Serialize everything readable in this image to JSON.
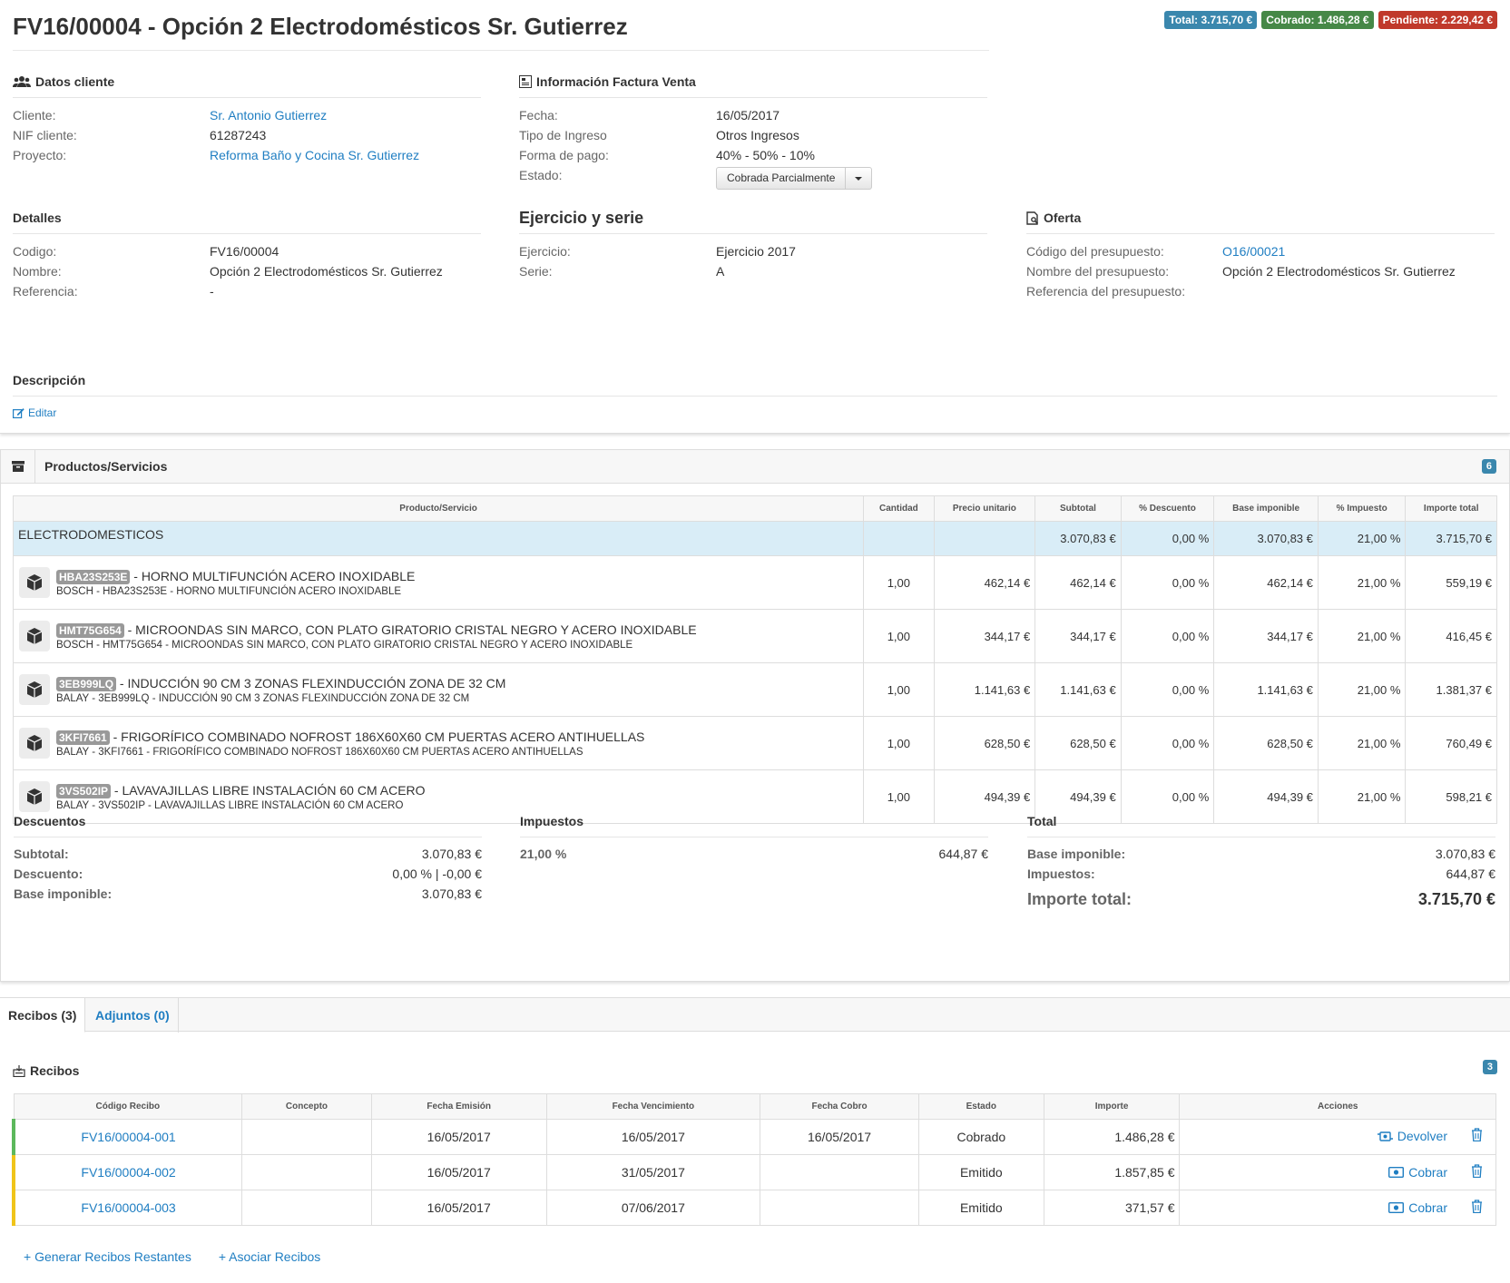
{
  "title": "FV16/00004 - Opción 2 Electrodomésticos Sr. Gutierrez",
  "totals": {
    "total": "Total: 3.715,70 €",
    "cobrado": "Cobrado: 1.486,28 €",
    "pendiente": "Pendiente: 2.229,42 €"
  },
  "cliente": {
    "heading": "Datos cliente",
    "cliente_label": "Cliente:",
    "cliente_value": "Sr. Antonio Gutierrez",
    "nif_label": "NIF cliente:",
    "nif_value": "61287243",
    "proyecto_label": "Proyecto:",
    "proyecto_value": "Reforma Baño y Cocina Sr. Gutierrez"
  },
  "factura": {
    "heading": "Información Factura Venta",
    "fecha_label": "Fecha:",
    "fecha_value": "16/05/2017",
    "tipo_label": "Tipo de Ingreso",
    "tipo_value": "Otros Ingresos",
    "forma_label": "Forma de pago:",
    "forma_value": "40% - 50% - 10%",
    "estado_label": "Estado:",
    "estado_value": "Cobrada Parcialmente"
  },
  "detalles": {
    "heading": "Detalles",
    "codigo_label": "Codigo:",
    "codigo_value": "FV16/00004",
    "nombre_label": "Nombre:",
    "nombre_value": "Opción 2 Electrodomésticos Sr. Gutierrez",
    "referencia_label": "Referencia:",
    "referencia_value": "-"
  },
  "ejercicio": {
    "heading": "Ejercicio y serie",
    "ejercicio_label": "Ejercicio:",
    "ejercicio_value": "Ejercicio 2017",
    "serie_label": "Serie:",
    "serie_value": "A"
  },
  "oferta": {
    "heading": "Oferta",
    "codigo_label": "Código del presupuesto:",
    "codigo_value": "O16/00021",
    "nombre_label": "Nombre del presupuesto:",
    "nombre_value": "Opción 2 Electrodomésticos Sr. Gutierrez",
    "referencia_label": "Referencia del presupuesto:"
  },
  "descripcion": {
    "heading": "Descripción",
    "edit_label": "Editar"
  },
  "productos": {
    "heading": "Productos/Servicios",
    "count": "6",
    "columns": [
      "Producto/Servicio",
      "Cantidad",
      "Precio unitario",
      "Subtotal",
      "% Descuento",
      "Base imponible",
      "% Impuesto",
      "Importe total"
    ],
    "category": {
      "name": "ELECTRODOMESTICOS",
      "subtotal": "3.070,83 €",
      "descuento": "0,00 %",
      "base": "3.070,83 €",
      "impuesto": "21,00 %",
      "total": "3.715,70 €"
    },
    "rows": [
      {
        "code": "HBA23S253E",
        "name": " - HORNO MULTIFUNCIÓN ACERO INOXIDABLE",
        "detail": "BOSCH - HBA23S253E - HORNO MULTIFUNCIÓN ACERO INOXIDABLE",
        "cantidad": "1,00",
        "precio": "462,14 €",
        "subtotal": "462,14 €",
        "descuento": "0,00 %",
        "base": "462,14 €",
        "impuesto": "21,00 %",
        "total": "559,19 €"
      },
      {
        "code": "HMT75G654",
        "name": " - MICROONDAS SIN MARCO, CON PLATO GIRATORIO CRISTAL NEGRO Y ACERO INOXIDABLE",
        "detail": "BOSCH - HMT75G654 - MICROONDAS SIN MARCO, CON PLATO GIRATORIO CRISTAL NEGRO Y ACERO INOXIDABLE",
        "cantidad": "1,00",
        "precio": "344,17 €",
        "subtotal": "344,17 €",
        "descuento": "0,00 %",
        "base": "344,17 €",
        "impuesto": "21,00 %",
        "total": "416,45 €"
      },
      {
        "code": "3EB999LQ",
        "name": " - INDUCCIÓN 90 CM 3 ZONAS FLEXINDUCCIÓN ZONA DE 32 CM",
        "detail": "BALAY - 3EB999LQ - INDUCCIÓN 90 CM 3 ZONAS FLEXINDUCCIÓN ZONA DE 32 CM",
        "cantidad": "1,00",
        "precio": "1.141,63 €",
        "subtotal": "1.141,63 €",
        "descuento": "0,00 %",
        "base": "1.141,63 €",
        "impuesto": "21,00 %",
        "total": "1.381,37 €"
      },
      {
        "code": "3KFI7661",
        "name": " - FRIGORÍFICO COMBINADO NOFROST 186X60X60 CM PUERTAS ACERO ANTIHUELLAS",
        "detail": "BALAY - 3KFI7661 - FRIGORÍFICO COMBINADO NOFROST 186X60X60 CM PUERTAS ACERO ANTIHUELLAS",
        "cantidad": "1,00",
        "precio": "628,50 €",
        "subtotal": "628,50 €",
        "descuento": "0,00 %",
        "base": "628,50 €",
        "impuesto": "21,00 %",
        "total": "760,49 €"
      },
      {
        "code": "3VS502IP",
        "name": " - LAVAVAJILLAS LIBRE INSTALACIÓN 60 CM ACERO",
        "detail": "BALAY - 3VS502IP - LAVAVAJILLAS LIBRE INSTALACIÓN 60 CM ACERO",
        "cantidad": "1,00",
        "precio": "494,39 €",
        "subtotal": "494,39 €",
        "descuento": "0,00 %",
        "base": "494,39 €",
        "impuesto": "21,00 %",
        "total": "598,21 €"
      }
    ]
  },
  "descuentos": {
    "heading": "Descuentos",
    "subtotal_label": "Subtotal:",
    "subtotal_value": "3.070,83 €",
    "descuento_label": "Descuento:",
    "descuento_value": "0,00 % | -0,00 €",
    "base_label": "Base imponible:",
    "base_value": "3.070,83 €"
  },
  "impuestos": {
    "heading": "Impuestos",
    "rate": "21,00 %",
    "amount": "644,87 €"
  },
  "total": {
    "heading": "Total",
    "base_label": "Base imponible:",
    "base_value": "3.070,83 €",
    "impuestos_label": "Impuestos:",
    "impuestos_value": "644,87 €",
    "importe_label": "Importe total:",
    "importe_value": "3.715,70 €"
  },
  "tabs": {
    "recibos": "Recibos (3)",
    "adjuntos": "Adjuntos (0)"
  },
  "recibos": {
    "heading": "Recibos",
    "count": "3",
    "columns": [
      "Código Recibo",
      "Concepto",
      "Fecha Emisión",
      "Fecha Vencimiento",
      "Fecha Cobro",
      "Estado",
      "Importe",
      "Acciones"
    ],
    "rows": [
      {
        "codigo": "FV16/00004-001",
        "concepto": "",
        "emision": "16/05/2017",
        "vencimiento": "16/05/2017",
        "cobro": "16/05/2017",
        "estado": "Cobrado",
        "importe": "1.486,28 €",
        "action": "Devolver",
        "status_color": "#5cb85c"
      },
      {
        "codigo": "FV16/00004-002",
        "concepto": "",
        "emision": "16/05/2017",
        "vencimiento": "31/05/2017",
        "cobro": "",
        "estado": "Emitido",
        "importe": "1.857,85 €",
        "action": "Cobrar",
        "status_color": "#f0c419"
      },
      {
        "codigo": "FV16/00004-003",
        "concepto": "",
        "emision": "16/05/2017",
        "vencimiento": "07/06/2017",
        "cobro": "",
        "estado": "Emitido",
        "importe": "371,57 €",
        "action": "Cobrar",
        "status_color": "#f0c419"
      }
    ],
    "generar_label": "+ Generar Recibos Restantes",
    "asociar_label": "+ Asociar Recibos"
  }
}
